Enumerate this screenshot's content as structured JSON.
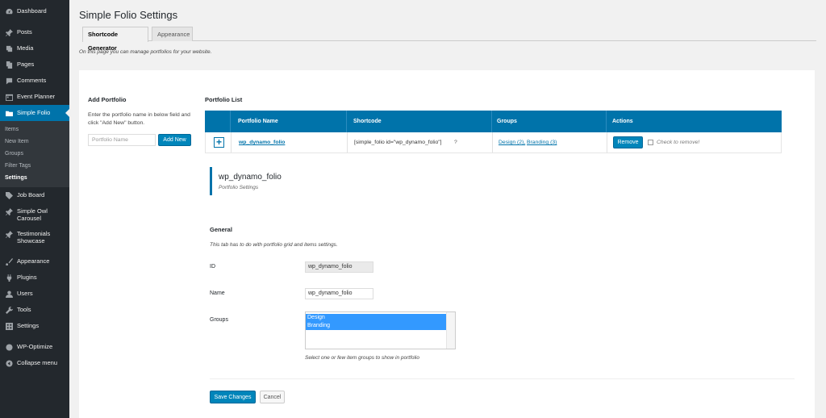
{
  "sidebar": {
    "items": [
      {
        "label": "Dashboard",
        "icon": "dashboard-icon"
      },
      {
        "label": "Posts",
        "icon": "pin-icon"
      },
      {
        "label": "Media",
        "icon": "media-icon"
      },
      {
        "label": "Pages",
        "icon": "pages-icon"
      },
      {
        "label": "Comments",
        "icon": "comment-icon"
      },
      {
        "label": "Event Planner",
        "icon": "calendar-icon"
      },
      {
        "label": "Simple Folio",
        "icon": "folder-icon"
      },
      {
        "label": "Job Board",
        "icon": "tag-icon"
      },
      {
        "label": "Simple Owl Carousel",
        "icon": "pin-icon"
      },
      {
        "label": "Testimonials Showcase",
        "icon": "pin-icon"
      },
      {
        "label": "Appearance",
        "icon": "brush-icon"
      },
      {
        "label": "Plugins",
        "icon": "plugin-icon"
      },
      {
        "label": "Users",
        "icon": "users-icon"
      },
      {
        "label": "Tools",
        "icon": "wrench-icon"
      },
      {
        "label": "Settings",
        "icon": "settings-icon"
      },
      {
        "label": "WP-Optimize",
        "icon": "optimize-icon"
      },
      {
        "label": "Collapse menu",
        "icon": "collapse-icon"
      }
    ],
    "submenu": [
      "Items",
      "New Item",
      "Groups",
      "Filter Tags",
      "Settings"
    ]
  },
  "page": {
    "title": "Simple Folio Settings",
    "tabs": [
      "Shortcode Generator",
      "Appearance"
    ],
    "intro": "On this page you can manage portfolios for your website."
  },
  "add_portfolio": {
    "heading": "Add Portfolio",
    "description": "Enter the portfolio name in below field and click \"Add New\" button.",
    "placeholder": "Portfolio Name",
    "button": "Add New"
  },
  "portfolio_list": {
    "heading": "Portfolio List",
    "columns": [
      "Portfolio Name",
      "Shortcode",
      "Groups",
      "Actions"
    ],
    "row": {
      "expand": "+",
      "name": "wp_dynamo_folio",
      "shortcode": "[simple_folio id=\"wp_dynamo_folio\"]",
      "shortcode_help": "?",
      "group1": "Design (2),",
      "group2": "Branding (3)",
      "remove": "Remove",
      "check_label": "Check to remove!"
    }
  },
  "settings": {
    "title": "wp_dynamo_folio",
    "subtitle": "Portfolio Settings",
    "general_heading": "General",
    "general_desc": "This tab has to do with portfolio grid and items settings.",
    "id_label": "ID",
    "id_value": "wp_dynamo_folio",
    "name_label": "Name",
    "name_value": "wp_dynamo_folio",
    "groups_label": "Groups",
    "groups_options": [
      "Design",
      "Branding"
    ],
    "groups_help": "Select one or few item groups to show in portfolio",
    "save": "Save Changes",
    "cancel": "Cancel"
  }
}
